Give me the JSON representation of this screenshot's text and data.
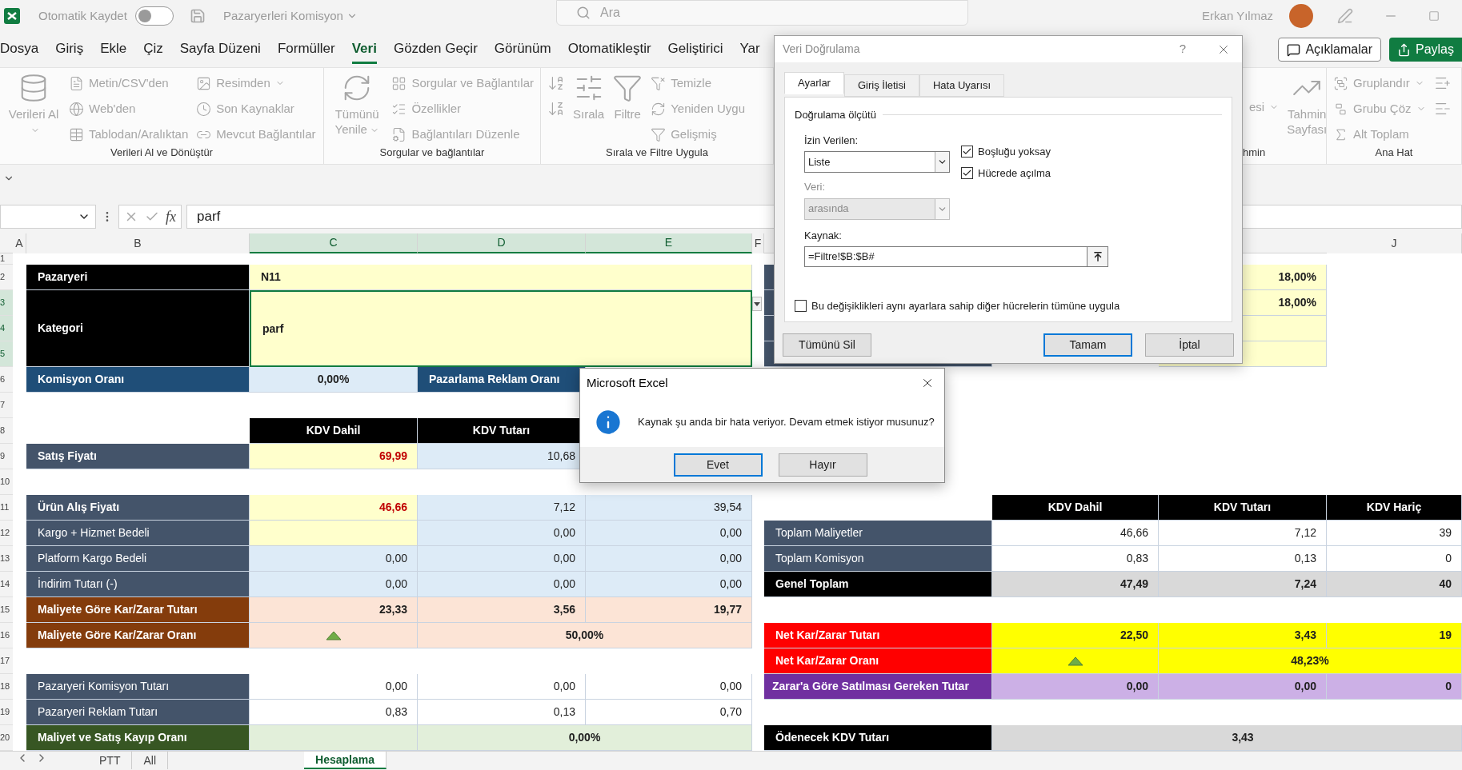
{
  "title_bar": {
    "autosave_label": "Otomatik Kaydet",
    "autosave_on": false,
    "file_name": "Pazaryerleri Komisyon",
    "search": {
      "placeholder": "Ara"
    },
    "user_name": "Erkan Yılmaz"
  },
  "menu": {
    "tabs": [
      {
        "label": "Dosya",
        "selected": false
      },
      {
        "label": "Giriş",
        "selected": false
      },
      {
        "label": "Ekle",
        "selected": false
      },
      {
        "label": "Çiz",
        "selected": false
      },
      {
        "label": "Sayfa Düzeni",
        "selected": false
      },
      {
        "label": "Formüller",
        "selected": false
      },
      {
        "label": "Veri",
        "selected": true
      },
      {
        "label": "Gözden Geçir",
        "selected": false
      },
      {
        "label": "Görünüm",
        "selected": false
      },
      {
        "label": "Otomatikleştir",
        "selected": false
      },
      {
        "label": "Geliştirici",
        "selected": false
      },
      {
        "label": "Yar",
        "selected": false
      }
    ],
    "buttons": [
      {
        "kind": "comments",
        "label": "Açıklamalar"
      },
      {
        "kind": "share",
        "label": "Paylaş"
      }
    ]
  },
  "ribbon": {
    "disabled": true,
    "groups": [
      {
        "label": "Verileri Al ve Dönüştür",
        "items": [
          {
            "kind": "large",
            "label": "Verileri Al",
            "menu": true
          },
          {
            "kind": "small",
            "label": "Metin/CSV'den",
            "menu": false
          },
          {
            "kind": "small",
            "label": "Web'den",
            "menu": false
          },
          {
            "kind": "small",
            "label": "Tablodan/Aralıktan",
            "menu": false
          },
          {
            "kind": "small",
            "label": "Resimden",
            "menu": true
          },
          {
            "kind": "small",
            "label": "Son Kaynaklar",
            "menu": false
          },
          {
            "kind": "small",
            "label": "Mevcut Bağlantılar",
            "menu": false
          }
        ]
      },
      {
        "label": "Sorgular ve bağlantılar",
        "items": [
          {
            "kind": "large",
            "label": "Tümünü Yenile",
            "menu": true
          },
          {
            "kind": "small",
            "label": "Sorgular ve Bağlantılar",
            "menu": false
          },
          {
            "kind": "small",
            "label": "Özellikler",
            "menu": false
          },
          {
            "kind": "small",
            "label": "Bağlantıları Düzenle",
            "menu": false
          }
        ]
      },
      {
        "label": "Sırala ve Filtre Uygula",
        "items": [
          {
            "kind": "icon"
          },
          {
            "kind": "icon"
          },
          {
            "kind": "large",
            "label": "Sırala",
            "menu": false
          },
          {
            "kind": "large",
            "label": "Filtre",
            "menu": false
          },
          {
            "kind": "small",
            "label": "Temizle",
            "menu": false
          },
          {
            "kind": "small",
            "label": "Yeniden Uygu",
            "menu": false
          },
          {
            "kind": "small",
            "label": "Gelişmiş",
            "menu": false
          }
        ]
      },
      {
        "label": "hmin",
        "items": [
          {
            "kind": "text",
            "label": "esi",
            "menu": true
          },
          {
            "kind": "large",
            "label": "Tahmin Sayfası",
            "menu": false
          }
        ]
      },
      {
        "label": "Ana Hat",
        "items": [
          {
            "kind": "small",
            "label": "Gruplandır",
            "menu": true
          },
          {
            "kind": "small",
            "label": "Grubu Çöz",
            "menu": true
          },
          {
            "kind": "small",
            "label": "Alt Toplam",
            "menu": false
          },
          {
            "kind": "icon"
          },
          {
            "kind": "icon"
          }
        ]
      }
    ]
  },
  "formula_bar": {
    "function_button": "fx",
    "value": "parf"
  },
  "sheet": {
    "column_headers": [
      {
        "label": "A",
        "selected": false
      },
      {
        "label": "B",
        "selected": false
      },
      {
        "label": "C",
        "selected": true
      },
      {
        "label": "D",
        "selected": true
      },
      {
        "label": "E",
        "selected": true
      },
      {
        "label": "F",
        "selected": false
      },
      {
        "label": "J",
        "selected": false
      }
    ],
    "row_headers": [
      {
        "label": "1",
        "selected": false
      },
      {
        "label": "2",
        "selected": false
      },
      {
        "label": "3",
        "selected": true
      },
      {
        "label": "4",
        "selected": true
      },
      {
        "label": "5",
        "selected": true
      },
      {
        "label": "6",
        "selected": false
      },
      {
        "label": "7",
        "selected": false
      },
      {
        "label": "8",
        "selected": false
      },
      {
        "label": "9",
        "selected": false
      },
      {
        "label": "10",
        "selected": false
      },
      {
        "label": "11",
        "selected": false
      },
      {
        "label": "12",
        "selected": false
      },
      {
        "label": "13",
        "selected": false
      },
      {
        "label": "14",
        "selected": false
      },
      {
        "label": "15",
        "selected": false
      },
      {
        "label": "16",
        "selected": false
      },
      {
        "label": "17",
        "selected": false
      },
      {
        "label": "18",
        "selected": false
      },
      {
        "label": "19",
        "selected": false
      },
      {
        "label": "20",
        "selected": false
      }
    ],
    "cells": [
      {
        "kind": "dark-label",
        "text": "Pazaryeri",
        "selected": false
      },
      {
        "kind": "input",
        "text": "N11",
        "selected": false
      },
      {
        "kind": "dark-label",
        "text": "Kategori",
        "selected": false
      },
      {
        "kind": "input",
        "text": "parf",
        "selected": true
      },
      {
        "kind": "navy-label",
        "text": "Komisyon Oranı",
        "selected": false
      },
      {
        "kind": "rate",
        "text": "0,00%",
        "selected": false
      },
      {
        "kind": "navy-label",
        "text": "Pazarlama Reklam Oranı",
        "selected": false
      },
      {
        "kind": "column-head",
        "text": "KDV Dahil",
        "selected": false
      },
      {
        "kind": "column-head",
        "text": "KDV Tutarı",
        "selected": false
      },
      {
        "kind": "slate-bold-label",
        "text": "Satış Fiyatı",
        "selected": false
      },
      {
        "kind": "price",
        "text": "69,99",
        "selected": false
      },
      {
        "kind": "blue",
        "text": "10,68",
        "selected": false
      },
      {
        "kind": "slate-bold-label",
        "text": "Ürün Alış Fiyatı",
        "selected": false
      },
      {
        "kind": "price",
        "text": "46,66",
        "selected": false
      },
      {
        "kind": "blue",
        "text": "7,12",
        "selected": false
      },
      {
        "kind": "blue",
        "text": "39,54",
        "selected": false
      },
      {
        "kind": "slate-label",
        "text": "Kargo + Hizmet Bedeli",
        "selected": false
      },
      {
        "kind": "input",
        "selected": false
      },
      {
        "kind": "blue",
        "text": "0,00",
        "selected": false
      },
      {
        "kind": "blue",
        "text": "0,00",
        "selected": false
      },
      {
        "kind": "slate-label",
        "text": "Platform Kargo Bedeli",
        "selected": false
      },
      {
        "kind": "blue",
        "text": "0,00",
        "selected": false
      },
      {
        "kind": "blue",
        "text": "0,00",
        "selected": false
      },
      {
        "kind": "blue",
        "text": "0,00",
        "selected": false
      },
      {
        "kind": "slate-label",
        "text": "İndirim Tutarı (-)",
        "selected": false
      },
      {
        "kind": "blue",
        "text": "0,00",
        "selected": false
      },
      {
        "kind": "blue",
        "text": "0,00",
        "selected": false
      },
      {
        "kind": "blue",
        "text": "0,00",
        "selected": false
      },
      {
        "kind": "brown-label",
        "text": "Maliyete Göre Kar/Zarar Tutarı",
        "selected": false
      },
      {
        "kind": "peach",
        "text": "23,33",
        "selected": false
      },
      {
        "kind": "peach",
        "text": "3,56",
        "selected": false
      },
      {
        "kind": "peach",
        "text": "19,77",
        "selected": false
      },
      {
        "kind": "brown-label",
        "text": "Maliyete Göre Kar/Zarar Oranı",
        "selected": false
      },
      {
        "kind": "peach-trend",
        "selected": false
      },
      {
        "kind": "peach-center",
        "text": "50,00%",
        "selected": false
      },
      {
        "kind": "slate-label",
        "text": "Pazaryeri Komisyon Tutarı",
        "selected": false
      },
      {
        "kind": "plain",
        "text": "0,00",
        "selected": false
      },
      {
        "kind": "plain",
        "text": "0,00",
        "selected": false
      },
      {
        "kind": "plain",
        "text": "0,00",
        "selected": false
      },
      {
        "kind": "slate-label",
        "text": "Pazaryeri Reklam Tutarı",
        "selected": false
      },
      {
        "kind": "plain",
        "text": "0,83",
        "selected": false
      },
      {
        "kind": "plain",
        "text": "0,13",
        "selected": false
      },
      {
        "kind": "plain",
        "text": "0,70",
        "selected": false
      },
      {
        "kind": "green-label",
        "text": "Maliyet ve Satış Kayıp Oranı",
        "selected": false
      },
      {
        "kind": "mint",
        "selected": false
      },
      {
        "kind": "mint",
        "text": "0,00%",
        "selected": false
      },
      {
        "kind": "slate-label",
        "selected": false
      },
      {
        "kind": "slate-label",
        "selected": false
      },
      {
        "kind": "slate-label",
        "selected": false
      },
      {
        "kind": "slate-label",
        "selected": false
      },
      {
        "kind": "input-number",
        "text": "18,00%",
        "selected": false
      },
      {
        "kind": "input-number",
        "text": "18,00%",
        "selected": false
      },
      {
        "kind": "input-number",
        "selected": false
      },
      {
        "kind": "input-number",
        "selected": false
      },
      {
        "kind": "column-head",
        "text": "KDV Dahil",
        "selected": false
      },
      {
        "kind": "column-head",
        "text": "KDV Tutarı",
        "selected": false
      },
      {
        "kind": "column-head",
        "text": "KDV Hariç",
        "selected": false
      },
      {
        "kind": "slate-label",
        "text": "Toplam Maliyetler",
        "selected": false
      },
      {
        "kind": "plain",
        "text": "46,66",
        "selected": false
      },
      {
        "kind": "plain",
        "text": "7,12",
        "selected": false
      },
      {
        "kind": "plain",
        "text": "39",
        "selected": false
      },
      {
        "kind": "slate-label",
        "text": "Toplam Komisyon",
        "selected": false
      },
      {
        "kind": "plain",
        "text": "0,83",
        "selected": false
      },
      {
        "kind": "plain",
        "text": "0,13",
        "selected": false
      },
      {
        "kind": "plain",
        "text": "0",
        "selected": false
      },
      {
        "kind": "dark-label",
        "text": "Genel Toplam",
        "selected": false
      },
      {
        "kind": "gray",
        "text": "47,49",
        "selected": false
      },
      {
        "kind": "gray",
        "text": "7,24",
        "selected": false
      },
      {
        "kind": "gray",
        "text": "40",
        "selected": false
      },
      {
        "kind": "red-label",
        "text": "Net Kar/Zarar Tutarı",
        "selected": false
      },
      {
        "kind": "yellow",
        "text": "22,50",
        "selected": false
      },
      {
        "kind": "yellow",
        "text": "3,43",
        "selected": false
      },
      {
        "kind": "yellow",
        "text": "19",
        "selected": false
      },
      {
        "kind": "red-label",
        "text": "Net Kar/Zarar Oranı",
        "selected": false
      },
      {
        "kind": "yellow-trend",
        "selected": false
      },
      {
        "kind": "yellow-center",
        "text": "48,23%",
        "selected": false
      },
      {
        "kind": "purple-label",
        "text": "Zarar'a Göre Satılması Gereken Tutar",
        "selected": false
      },
      {
        "kind": "lavender",
        "text": "0,00",
        "selected": false
      },
      {
        "kind": "lavender",
        "text": "0,00",
        "selected": false
      },
      {
        "kind": "lavender",
        "text": "0",
        "selected": false
      },
      {
        "kind": "dark-label",
        "text": "Ödenecek KDV Tutarı",
        "selected": false
      },
      {
        "kind": "gray-center",
        "text": "3,43",
        "selected": false
      }
    ]
  },
  "sheet_tabs": [
    {
      "label": "PTT",
      "selected": false
    },
    {
      "label": "All",
      "selected": false
    },
    {
      "label": "Hesaplama",
      "selected": true
    }
  ],
  "validation_dialog": {
    "title": "Veri Doğrulama",
    "active": false,
    "help": "?",
    "tabs": [
      {
        "label": "Ayarlar",
        "selected": true
      },
      {
        "label": "Giriş İletisi",
        "selected": false
      },
      {
        "label": "Hata Uyarısı",
        "selected": false
      }
    ],
    "section": "Doğrulama ölçütü",
    "allow": {
      "label": "İzin Verilen:",
      "value": "Liste",
      "disabled": false
    },
    "data": {
      "label": "Veri:",
      "value": "arasında",
      "disabled": true
    },
    "options": [
      {
        "label": "Boşluğu yoksay",
        "checked": true
      },
      {
        "label": "Hücrede açılma",
        "checked": true
      }
    ],
    "source": {
      "label": "Kaynak:",
      "value": "=Filtre!$B:$B#"
    },
    "apply_all": {
      "label": "Bu değişiklikleri aynı ayarlara sahip diğer hücrelerin tümüne uygula",
      "checked": false
    },
    "buttons": [
      {
        "label": "Tümünü Sil",
        "default": false
      },
      {
        "label": "Tamam",
        "default": true
      },
      {
        "label": "İptal",
        "default": false
      }
    ]
  },
  "message_box": {
    "title": "Microsoft Excel",
    "active": true,
    "message": "Kaynak şu anda bir hata veriyor. Devam etmek istiyor musunuz?",
    "buttons": [
      {
        "label": "Evet",
        "default": true
      },
      {
        "label": "Hayır",
        "default": false
      }
    ]
  }
}
